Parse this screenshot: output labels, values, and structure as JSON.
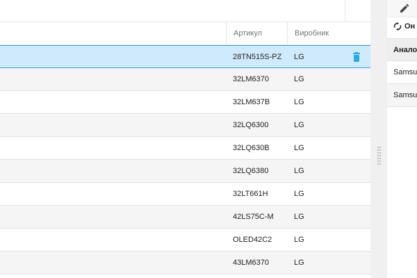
{
  "grid": {
    "columns": {
      "article": "Артикул",
      "manufacturer": "Виробник"
    },
    "rows": [
      {
        "article": "28TN515S-PZ",
        "manufacturer": "LG",
        "selected": true
      },
      {
        "article": "32LM6370",
        "manufacturer": "LG"
      },
      {
        "article": "32LM637B",
        "manufacturer": "LG"
      },
      {
        "article": "32LQ6300",
        "manufacturer": "LG"
      },
      {
        "article": "32LQ630B",
        "manufacturer": "LG"
      },
      {
        "article": "32LQ6380",
        "manufacturer": "LG"
      },
      {
        "article": "32LT661H",
        "manufacturer": "LG"
      },
      {
        "article": "42LS75C-M",
        "manufacturer": "LG"
      },
      {
        "article": "OLED42C2",
        "manufacturer": "LG"
      },
      {
        "article": "43LM6370",
        "manufacturer": "LG"
      }
    ],
    "delete_icon": "trash-icon",
    "selection_color": "#cfeafc",
    "accent_color": "#29a8f0"
  },
  "side": {
    "edit_icon": "pencil-icon",
    "refresh_icon": "refresh-icon",
    "refresh_label": "Он",
    "table_header": "Аналог",
    "rows": [
      "Samsu",
      "Samsu"
    ]
  }
}
